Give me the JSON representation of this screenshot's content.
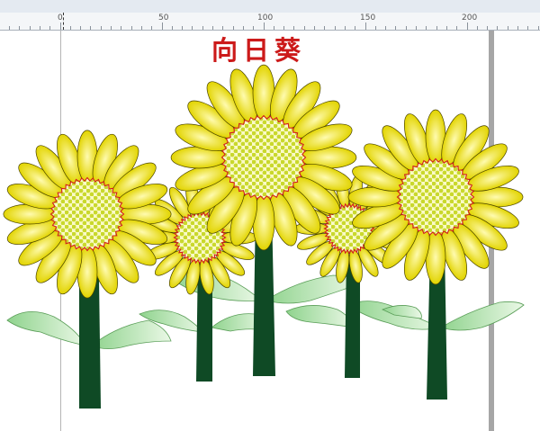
{
  "ruler": {
    "labels": [
      "0",
      "50",
      "100",
      "150",
      "200"
    ]
  },
  "document": {
    "title": "向日葵"
  },
  "colors": {
    "petal_outer": "#e2d400",
    "petal_inner": "#fffbb0",
    "center": "#d6e03a",
    "center_outline": "#d21e1e",
    "stem": "#0f4a25",
    "leaf": "#8fd38d",
    "leaf_light": "#eaf8e6"
  },
  "icons": [
    "flower-icon",
    "leaf-icon"
  ]
}
